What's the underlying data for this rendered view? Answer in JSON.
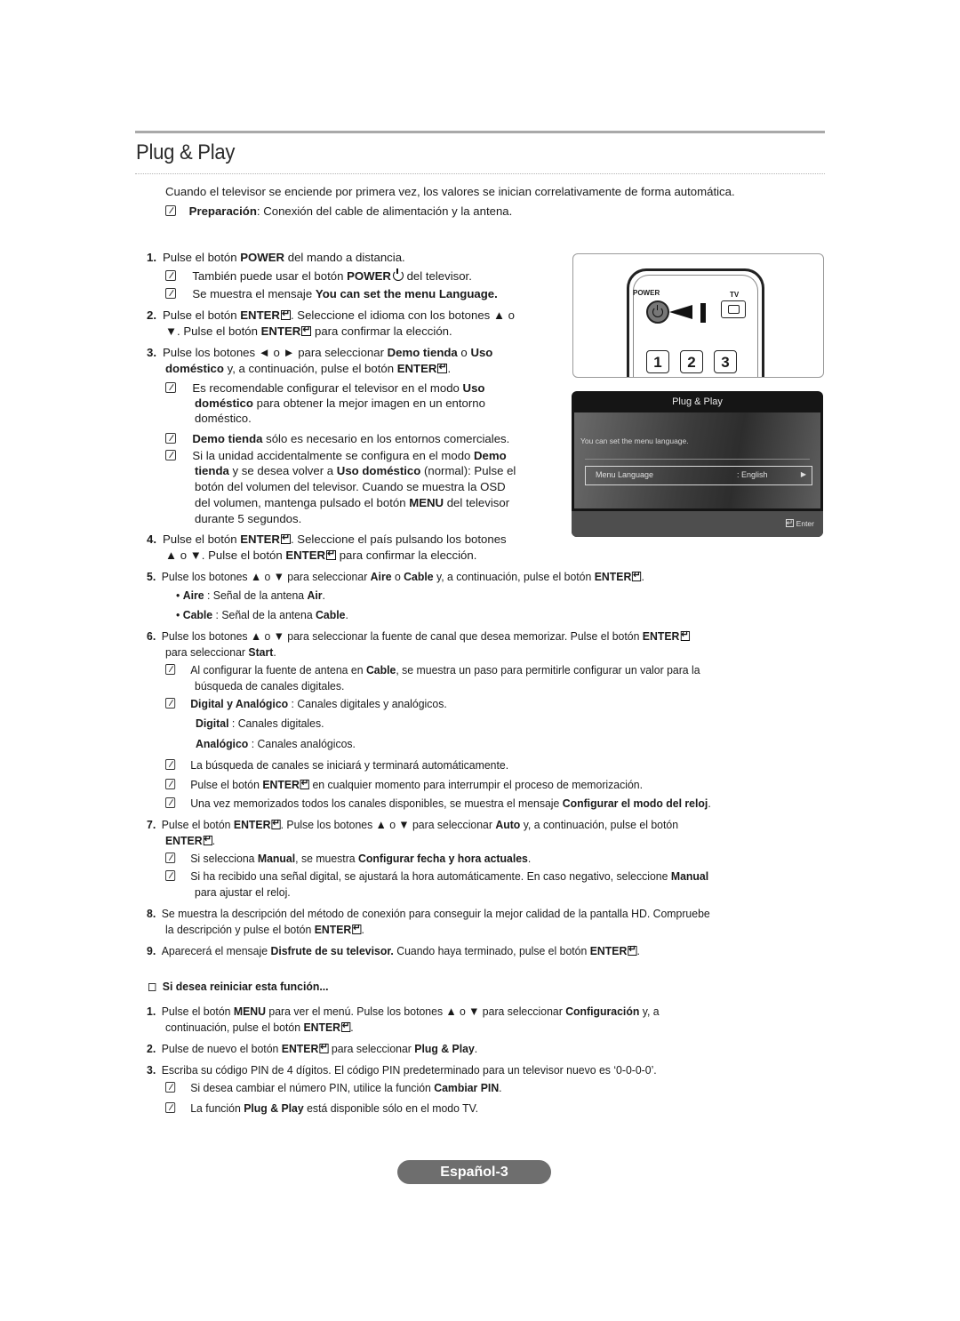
{
  "page": {
    "title": "Plug & Play",
    "intro": "Cuando el televisor se enciende por primera vez, los valores se inician correlativamente de forma automática.",
    "prep_bold": "Preparación",
    "prep_rest": ": Conexión del cable de alimentación y la antena.",
    "footer": "Español-3"
  },
  "remote": {
    "power_label": "POWER",
    "tv_label": "TV",
    "keys": [
      "1",
      "2",
      "3"
    ]
  },
  "osd": {
    "title": "Plug & Play",
    "message": "You can set the menu language.",
    "field_label": "Menu Language",
    "field_value": ": English",
    "field_arrow": "▶",
    "enter_label": "Enter"
  },
  "steps": {
    "s1": {
      "num": "1.",
      "a": "Pulse el botón ",
      "b": "POWER",
      "c": " del mando a distancia."
    },
    "s1n1": {
      "a": "También puede usar el botón ",
      "b": "POWER",
      "c": " del televisor."
    },
    "s1n2": {
      "a": "Se muestra el mensaje ",
      "b": "You can set the menu Language."
    },
    "s2": {
      "num": "2.",
      "a": "Pulse el botón ",
      "b": "ENTER",
      "c": ". Seleccione el idioma con los botones ▲ o"
    },
    "s2l2": {
      "a": "▼. Pulse el botón ",
      "b": "ENTER",
      "c": " para confirmar la elección."
    },
    "s3": {
      "num": "3.",
      "a": "Pulse los botones ◄ o ► para seleccionar ",
      "b": "Demo tienda",
      "c": " o ",
      "d": "Uso"
    },
    "s3l2": {
      "a": "doméstico",
      "b": " y, a continuación, pulse el botón ",
      "c": "ENTER",
      "d": "."
    },
    "s3n1l1": {
      "a": "Es recomendable configurar el televisor en el modo ",
      "b": "Uso"
    },
    "s3n1l2": {
      "a": "doméstico",
      "b": " para obtener la mejor imagen en un entorno"
    },
    "s3n1l3": {
      "a": "doméstico."
    },
    "s3n2": {
      "a": "Demo tienda",
      "b": " sólo es necesario en los entornos comerciales."
    },
    "s3n3l1": {
      "a": "Si la unidad accidentalmente se configura en el modo ",
      "b": "Demo"
    },
    "s3n3l2": {
      "a": "tienda",
      "b": " y se desea volver a ",
      "c": "Uso doméstico",
      "d": " (normal): Pulse el"
    },
    "s3n3l3": {
      "a": "botón del volumen del televisor. Cuando se muestra la OSD"
    },
    "s3n3l4": {
      "a": "del volumen, mantenga pulsado el botón ",
      "b": "MENU",
      "c": " del televisor"
    },
    "s3n3l5": {
      "a": "durante 5 segundos."
    },
    "s4": {
      "num": "4.",
      "a": "Pulse el botón ",
      "b": "ENTER",
      "c": ". Seleccione el país pulsando los botones"
    },
    "s4l2": {
      "a": "▲ o ▼. Pulse el botón ",
      "b": "ENTER",
      "c": " para confirmar la elección."
    },
    "s5": {
      "num": "5.",
      "a": "Pulse los botones ▲ o ▼ para seleccionar ",
      "b": "Aire",
      "c": " o ",
      "d": "Cable",
      "e": " y, a continuación, pulse el botón ",
      "f": "ENTER",
      "g": "."
    },
    "s5b1": {
      "bullet": "•",
      "a": "Aire",
      "b": " : Señal de la antena ",
      "c": "Air",
      "d": "."
    },
    "s5b2": {
      "bullet": "•",
      "a": "Cable",
      "b": " : Señal de la antena ",
      "c": "Cable",
      "d": "."
    },
    "s6": {
      "num": "6.",
      "a": "Pulse los botones ▲ o ▼ para seleccionar la fuente de canal que desea memorizar. Pulse el botón ",
      "b": "ENTER"
    },
    "s6l2": {
      "a": "para seleccionar ",
      "b": "Start",
      "c": "."
    },
    "s6n1l1": {
      "a": "Al configurar la fuente de antena en ",
      "b": "Cable",
      "c": ", se muestra un paso para permitirle configurar un valor para la"
    },
    "s6n1l2": {
      "a": "búsqueda de canales digitales."
    },
    "s6n2": {
      "a": "Digital y Analógico",
      "b": " : Canales digitales y analógicos."
    },
    "s6n2l2": {
      "a": "Digital",
      "b": " : Canales digitales."
    },
    "s6n2l3": {
      "a": "Analógico",
      "b": " : Canales analógicos."
    },
    "s6n3": {
      "a": "La búsqueda de canales se iniciará y terminará automáticamente."
    },
    "s6n4": {
      "a": "Pulse el botón ",
      "b": "ENTER",
      "c": " en cualquier momento para interrumpir el proceso de memorización."
    },
    "s6n5": {
      "a": "Una vez memorizados todos los canales disponibles, se muestra el mensaje ",
      "b": "Configurar el modo del reloj",
      "c": "."
    },
    "s7": {
      "num": "7.",
      "a": "Pulse el botón ",
      "b": "ENTER",
      "c": ". Pulse los botones ▲ o ▼ para seleccionar ",
      "d": "Auto",
      "e": " y, a continuación, pulse el botón"
    },
    "s7l2": {
      "a": "ENTER",
      "b": "."
    },
    "s7n1": {
      "a": "Si selecciona ",
      "b": "Manual",
      "c": ", se muestra ",
      "d": "Configurar fecha y hora actuales",
      "e": "."
    },
    "s7n2l1": {
      "a": "Si ha recibido una señal digital, se ajustará la hora automáticamente. En caso negativo, seleccione ",
      "b": "Manual"
    },
    "s7n2l2": {
      "a": "para ajustar el reloj."
    },
    "s8": {
      "num": "8.",
      "a": "Se muestra la descripción del método de conexión para conseguir la mejor calidad de la pantalla HD. Compruebe"
    },
    "s8l2": {
      "a": "la descripción y pulse el botón ",
      "b": "ENTER",
      "c": "."
    },
    "s9": {
      "num": "9.",
      "a": "Aparecerá el mensaje ",
      "b": "Disfrute de su televisor.",
      "c": " Cuando haya terminado, pulse el botón ",
      "d": "ENTER",
      "e": "."
    }
  },
  "restart": {
    "heading": "Si desea reiniciar esta función...",
    "r1": {
      "num": "1.",
      "a": "Pulse el botón ",
      "b": "MENU",
      "c": " para ver el menú. Pulse los botones ▲ o ▼ para seleccionar ",
      "d": "Configuración",
      "e": " y, a"
    },
    "r1l2": {
      "a": "continuación, pulse el botón ",
      "b": "ENTER",
      "c": "."
    },
    "r2": {
      "num": "2.",
      "a": "Pulse de nuevo el botón ",
      "b": "ENTER",
      "c": " para seleccionar ",
      "d": "Plug & Play",
      "e": "."
    },
    "r3": {
      "num": "3.",
      "a": "Escriba su código PIN de 4 dígitos. El código PIN predeterminado para un televisor nuevo es ‘0-0-0-0’."
    },
    "r3n1": {
      "a": "Si desea cambiar el número PIN, utilice la función ",
      "b": "Cambiar PIN",
      "c": "."
    },
    "r3n2": {
      "a": "La función ",
      "b": "Plug & Play",
      "c": " está disponible sólo en el modo TV."
    }
  }
}
